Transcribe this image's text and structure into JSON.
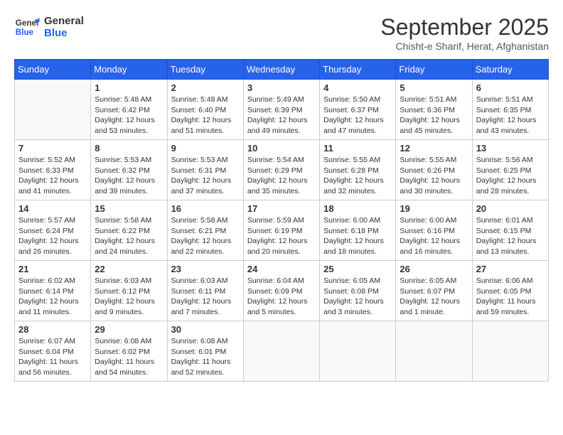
{
  "logo": {
    "line1": "General",
    "line2": "Blue"
  },
  "title": "September 2025",
  "subtitle": "Chisht-e Sharif, Herat, Afghanistan",
  "weekdays": [
    "Sunday",
    "Monday",
    "Tuesday",
    "Wednesday",
    "Thursday",
    "Friday",
    "Saturday"
  ],
  "days": [
    {
      "date": null
    },
    {
      "date": "1",
      "sunrise": "5:48 AM",
      "sunset": "6:42 PM",
      "daylight": "12 hours and 53 minutes."
    },
    {
      "date": "2",
      "sunrise": "5:48 AM",
      "sunset": "6:40 PM",
      "daylight": "12 hours and 51 minutes."
    },
    {
      "date": "3",
      "sunrise": "5:49 AM",
      "sunset": "6:39 PM",
      "daylight": "12 hours and 49 minutes."
    },
    {
      "date": "4",
      "sunrise": "5:50 AM",
      "sunset": "6:37 PM",
      "daylight": "12 hours and 47 minutes."
    },
    {
      "date": "5",
      "sunrise": "5:51 AM",
      "sunset": "6:36 PM",
      "daylight": "12 hours and 45 minutes."
    },
    {
      "date": "6",
      "sunrise": "5:51 AM",
      "sunset": "6:35 PM",
      "daylight": "12 hours and 43 minutes."
    },
    {
      "date": "7",
      "sunrise": "5:52 AM",
      "sunset": "6:33 PM",
      "daylight": "12 hours and 41 minutes."
    },
    {
      "date": "8",
      "sunrise": "5:53 AM",
      "sunset": "6:32 PM",
      "daylight": "12 hours and 39 minutes."
    },
    {
      "date": "9",
      "sunrise": "5:53 AM",
      "sunset": "6:31 PM",
      "daylight": "12 hours and 37 minutes."
    },
    {
      "date": "10",
      "sunrise": "5:54 AM",
      "sunset": "6:29 PM",
      "daylight": "12 hours and 35 minutes."
    },
    {
      "date": "11",
      "sunrise": "5:55 AM",
      "sunset": "6:28 PM",
      "daylight": "12 hours and 32 minutes."
    },
    {
      "date": "12",
      "sunrise": "5:55 AM",
      "sunset": "6:26 PM",
      "daylight": "12 hours and 30 minutes."
    },
    {
      "date": "13",
      "sunrise": "5:56 AM",
      "sunset": "6:25 PM",
      "daylight": "12 hours and 28 minutes."
    },
    {
      "date": "14",
      "sunrise": "5:57 AM",
      "sunset": "6:24 PM",
      "daylight": "12 hours and 26 minutes."
    },
    {
      "date": "15",
      "sunrise": "5:58 AM",
      "sunset": "6:22 PM",
      "daylight": "12 hours and 24 minutes."
    },
    {
      "date": "16",
      "sunrise": "5:58 AM",
      "sunset": "6:21 PM",
      "daylight": "12 hours and 22 minutes."
    },
    {
      "date": "17",
      "sunrise": "5:59 AM",
      "sunset": "6:19 PM",
      "daylight": "12 hours and 20 minutes."
    },
    {
      "date": "18",
      "sunrise": "6:00 AM",
      "sunset": "6:18 PM",
      "daylight": "12 hours and 18 minutes."
    },
    {
      "date": "19",
      "sunrise": "6:00 AM",
      "sunset": "6:16 PM",
      "daylight": "12 hours and 16 minutes."
    },
    {
      "date": "20",
      "sunrise": "6:01 AM",
      "sunset": "6:15 PM",
      "daylight": "12 hours and 13 minutes."
    },
    {
      "date": "21",
      "sunrise": "6:02 AM",
      "sunset": "6:14 PM",
      "daylight": "12 hours and 11 minutes."
    },
    {
      "date": "22",
      "sunrise": "6:03 AM",
      "sunset": "6:12 PM",
      "daylight": "12 hours and 9 minutes."
    },
    {
      "date": "23",
      "sunrise": "6:03 AM",
      "sunset": "6:11 PM",
      "daylight": "12 hours and 7 minutes."
    },
    {
      "date": "24",
      "sunrise": "6:04 AM",
      "sunset": "6:09 PM",
      "daylight": "12 hours and 5 minutes."
    },
    {
      "date": "25",
      "sunrise": "6:05 AM",
      "sunset": "6:08 PM",
      "daylight": "12 hours and 3 minutes."
    },
    {
      "date": "26",
      "sunrise": "6:05 AM",
      "sunset": "6:07 PM",
      "daylight": "12 hours and 1 minute."
    },
    {
      "date": "27",
      "sunrise": "6:06 AM",
      "sunset": "6:05 PM",
      "daylight": "11 hours and 59 minutes."
    },
    {
      "date": "28",
      "sunrise": "6:07 AM",
      "sunset": "6:04 PM",
      "daylight": "11 hours and 56 minutes."
    },
    {
      "date": "29",
      "sunrise": "6:08 AM",
      "sunset": "6:02 PM",
      "daylight": "11 hours and 54 minutes."
    },
    {
      "date": "30",
      "sunrise": "6:08 AM",
      "sunset": "6:01 PM",
      "daylight": "11 hours and 52 minutes."
    },
    {
      "date": null
    },
    {
      "date": null
    },
    {
      "date": null
    },
    {
      "date": null
    }
  ],
  "labels": {
    "sunrise": "Sunrise:",
    "sunset": "Sunset:",
    "daylight": "Daylight:"
  }
}
